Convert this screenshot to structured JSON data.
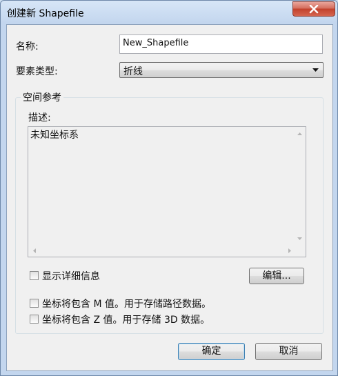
{
  "window": {
    "title": "创建新 Shapefile"
  },
  "form": {
    "name_label": "名称:",
    "name_value": "New_Shapefile",
    "feature_type_label": "要素类型:",
    "feature_type_value": "折线"
  },
  "spatial_reference": {
    "group_title": "空间参考",
    "description_label": "描述:",
    "description_text": "未知坐标系",
    "show_details_label": "显示详细信息",
    "edit_button": "编辑..."
  },
  "options": {
    "m_values_label": "坐标将包含 M 值。用于存储路径数据。",
    "z_values_label": "坐标将包含 Z 值。用于存储 3D 数据。"
  },
  "footer": {
    "ok_button": "确定",
    "cancel_button": "取消"
  },
  "icons": {
    "close": "close-icon",
    "dropdown": "chevron-down-icon"
  },
  "colors": {
    "close_button": "#c2412c",
    "default_button_border": "#3c7fb1"
  }
}
